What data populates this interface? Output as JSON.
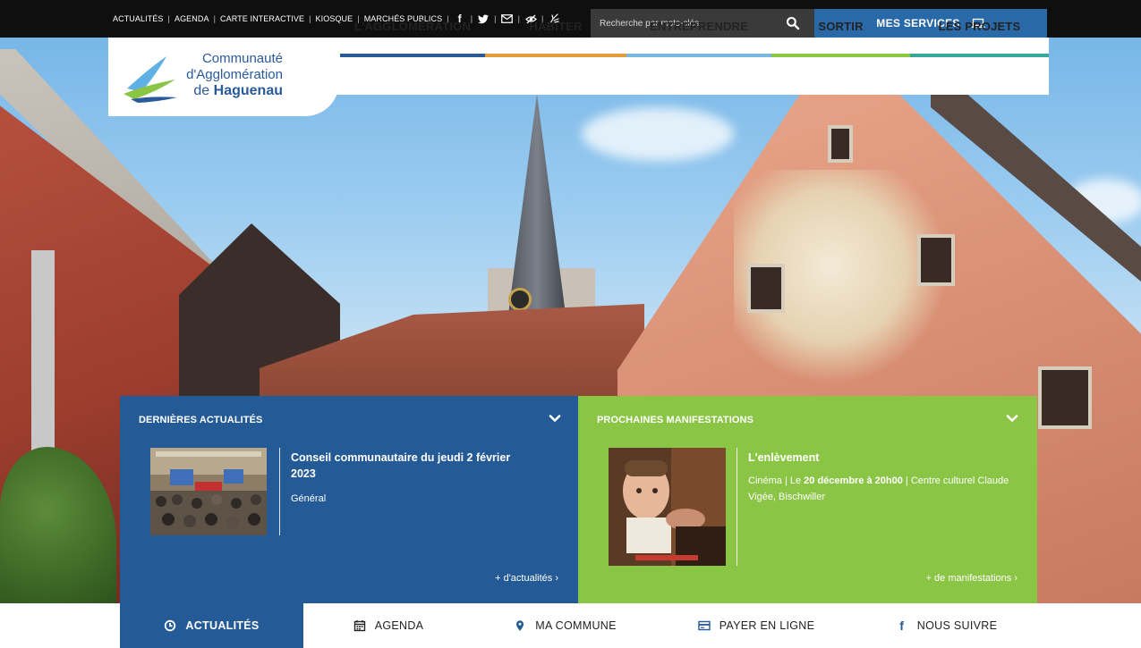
{
  "topbar": {
    "links": [
      "ACTUALITÉS",
      "AGENDA",
      "CARTE INTERACTIVE",
      "KIOSQUE",
      "MARCHÉS PUBLICS"
    ],
    "social_icons": [
      "facebook-icon",
      "twitter-icon",
      "mail-icon",
      "accessibility-icon",
      "sign-language-icon"
    ],
    "search_placeholder": "Recherche par mots-clés",
    "services_label": "MES SERVICES"
  },
  "logo": {
    "line1": "Communauté",
    "line2": "d'Agglomération",
    "line3_prefix": "de ",
    "line3_bold": "Haguenau"
  },
  "nav": {
    "items": [
      {
        "label": "L'AGGLOMÉRATION",
        "color": "#2a5a9a"
      },
      {
        "label": "HABITER",
        "color": "#e39a3a"
      },
      {
        "label": "ENTREPRENDRE",
        "color": "#79b7e3"
      },
      {
        "label": "SORTIR",
        "color": "#8bc545"
      },
      {
        "label": "LES PROJETS",
        "color": "#3aa79b"
      }
    ]
  },
  "news": {
    "heading": "DERNIÈRES ACTUALITÉS",
    "title": "Conseil communautaire du jeudi 2 février 2023",
    "category": "Général",
    "more_link": "+ d'actualités  ›",
    "color": "#245a96"
  },
  "events": {
    "heading": "PROCHAINES MANIFESTATIONS",
    "title": "L'enlèvement",
    "meta_type": "Cinéma",
    "meta_sep1": " | Le ",
    "meta_date": "20 décembre à 20h00",
    "meta_place": " | Centre culturel Claude Vigée, Bischwiller",
    "more_link": "+ de manifestations  ›",
    "color": "#8bc545"
  },
  "bottom_nav": {
    "items": [
      {
        "label": "ACTUALITÉS",
        "icon": "clock-icon",
        "active": true
      },
      {
        "label": "AGENDA",
        "icon": "calendar-icon",
        "active": false
      },
      {
        "label": "MA COMMUNE",
        "icon": "map-pin-icon",
        "active": false
      },
      {
        "label": "PAYER EN LIGNE",
        "icon": "credit-card-icon",
        "active": false
      },
      {
        "label": "NOUS SUIVRE",
        "icon": "facebook-icon",
        "active": false
      }
    ]
  }
}
